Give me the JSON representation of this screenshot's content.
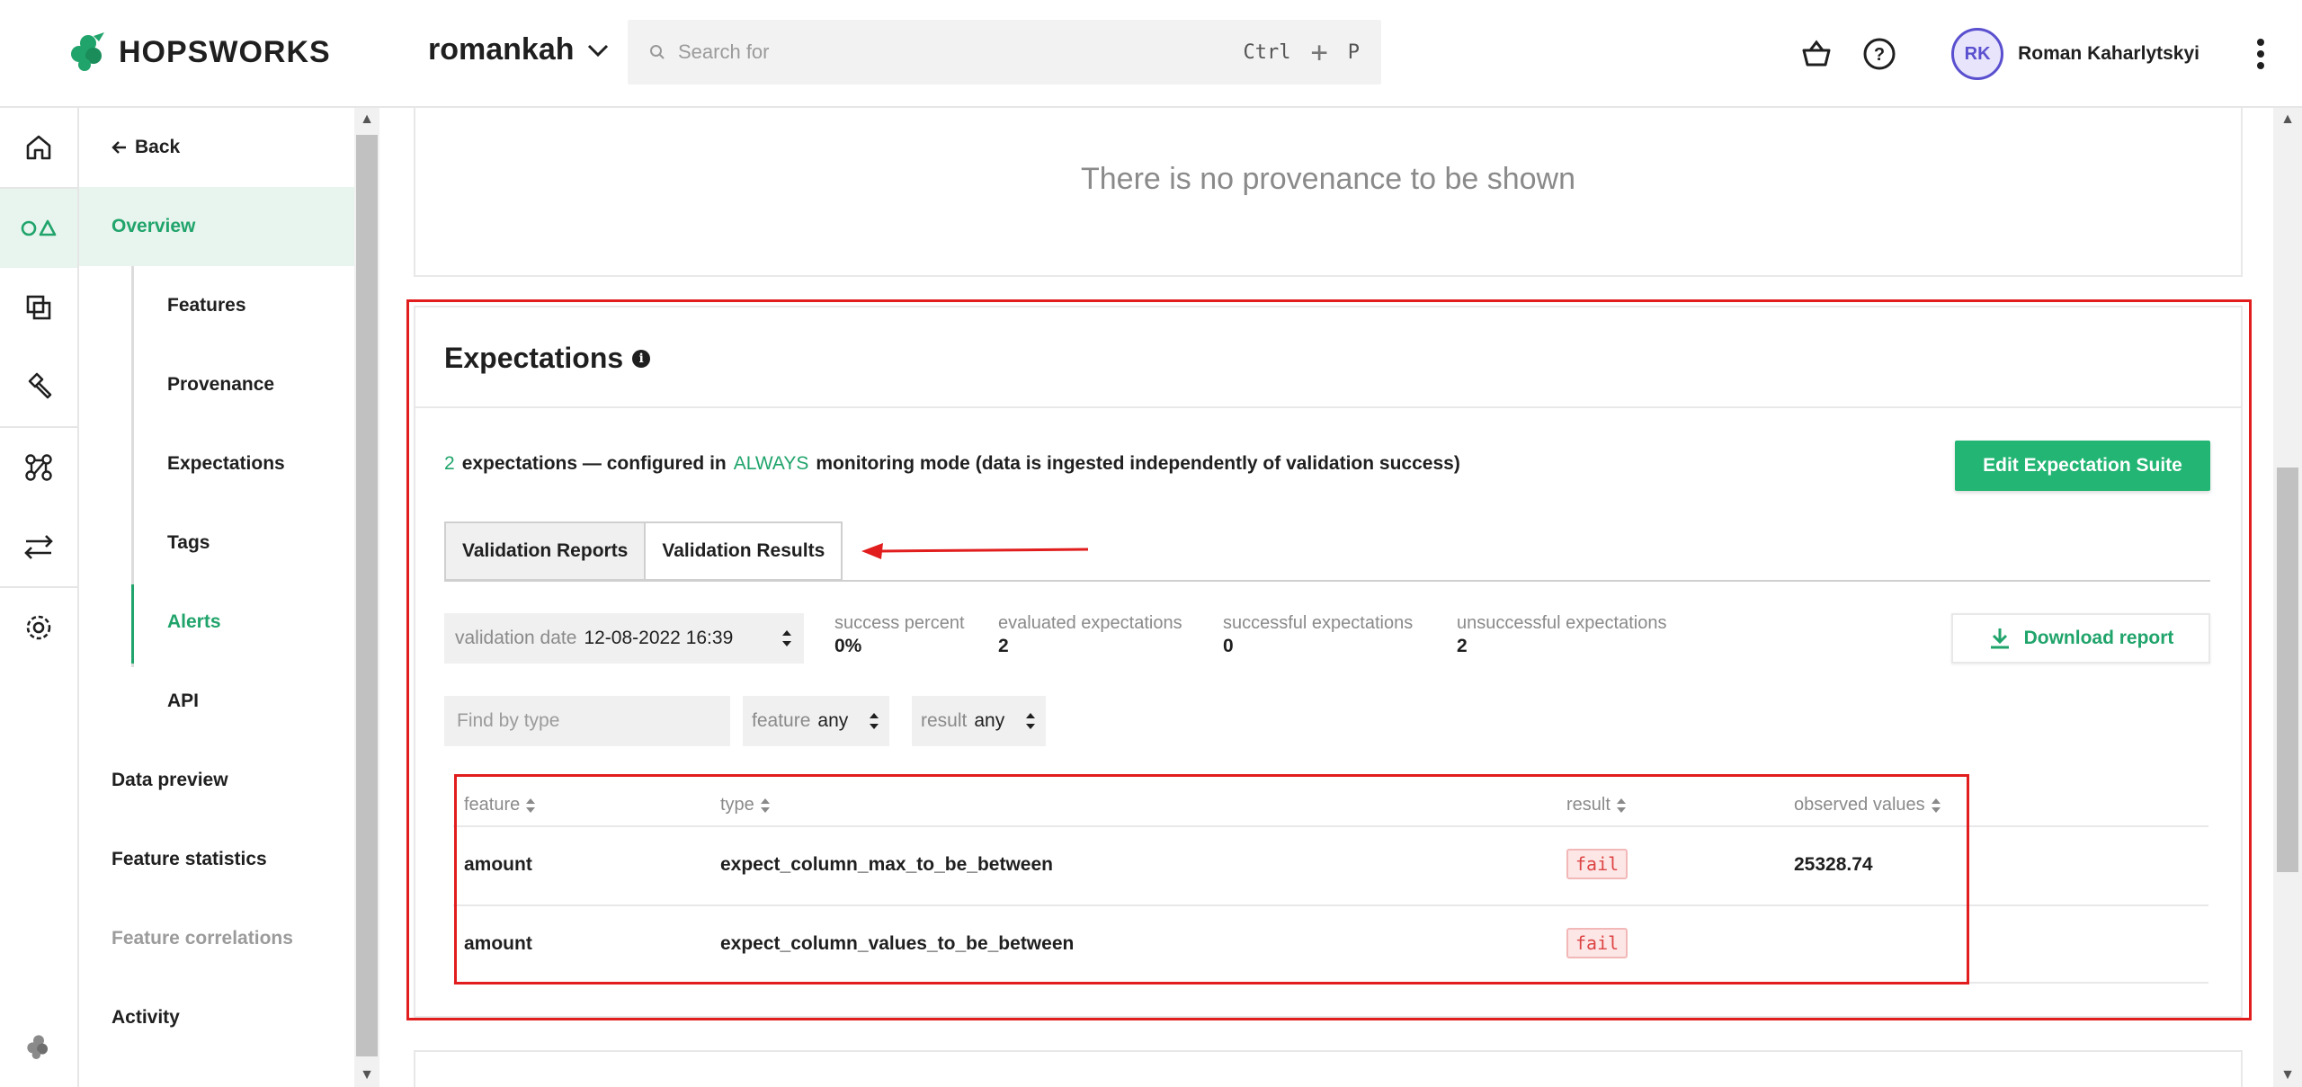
{
  "header": {
    "brand": "HOPSWORKS",
    "project": "romankah",
    "search_placeholder": "Search for",
    "shortcut_ctrl": "Ctrl",
    "shortcut_plus": "+",
    "shortcut_key": "P",
    "avatar_initials": "RK",
    "user_name": "Roman Kaharlytskyi"
  },
  "rail": {
    "icons": [
      "home-icon",
      "feature-store-icon",
      "copy-icon",
      "hammer-icon",
      "graph-icon",
      "transfer-icon",
      "settings-icon",
      "hopsworks-logo-icon"
    ]
  },
  "sidebar": {
    "back": "Back",
    "items": [
      {
        "label": "Overview"
      },
      {
        "label": "Features"
      },
      {
        "label": "Provenance"
      },
      {
        "label": "Expectations"
      },
      {
        "label": "Tags"
      },
      {
        "label": "Alerts"
      },
      {
        "label": "API"
      },
      {
        "label": "Data preview"
      },
      {
        "label": "Feature statistics"
      },
      {
        "label": "Feature correlations"
      },
      {
        "label": "Activity"
      }
    ]
  },
  "provenance": {
    "empty_message": "There is no provenance to be shown"
  },
  "expectations": {
    "title": "Expectations",
    "count": "2",
    "summary_a": "expectations — configured in",
    "mode": "ALWAYS",
    "summary_b": "monitoring mode (data is ingested independently of validation success)",
    "edit_button": "Edit Expectation Suite",
    "tabs": [
      "Validation Reports",
      "Validation Results"
    ],
    "date_label": "validation date",
    "date_value": "12-08-2022 16:39",
    "stats": [
      {
        "label": "success percent",
        "value": "0%"
      },
      {
        "label": "evaluated expectations",
        "value": "2"
      },
      {
        "label": "successful expectations",
        "value": "0"
      },
      {
        "label": "unsuccessful expectations",
        "value": "2"
      }
    ],
    "download_button": "Download report",
    "filter_placeholder": "Find by type",
    "feature_filter_label": "feature",
    "feature_filter_value": "any",
    "result_filter_label": "result",
    "result_filter_value": "any",
    "table": {
      "headers": [
        "feature",
        "type",
        "result",
        "observed values"
      ],
      "rows": [
        {
          "feature": "amount",
          "type": "expect_column_max_to_be_between",
          "result": "fail",
          "observed": "25328.74"
        },
        {
          "feature": "amount",
          "type": "expect_column_values_to_be_between",
          "result": "fail",
          "observed": ""
        }
      ]
    }
  },
  "colors": {
    "accent": "#20a46b",
    "primary_button": "#22b573",
    "annotation_red": "#e11d1d",
    "fail_badge": "#fde6e6"
  }
}
